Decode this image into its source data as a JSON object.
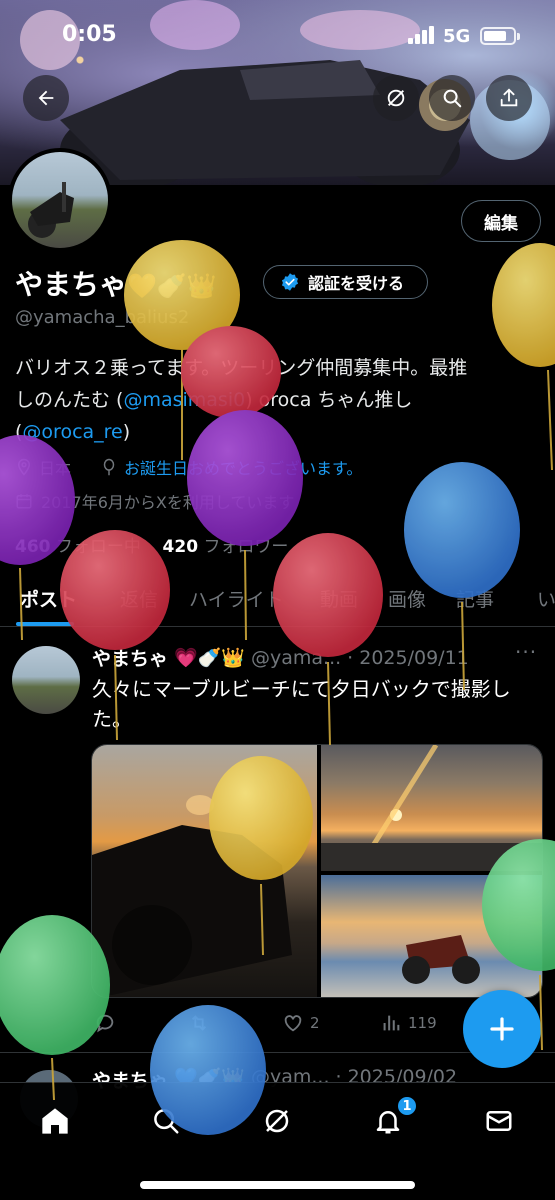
{
  "status_bar": {
    "time": "0:05",
    "network": "5G"
  },
  "header": {
    "back_icon": "arrow-left-icon",
    "grok_icon": "grok-icon",
    "search_icon": "search-icon",
    "share_icon": "share-icon"
  },
  "profile": {
    "edit_label": "編集",
    "name": "やまちゃ",
    "name_emojis": "🧡🍼👑",
    "verify_label": "認証を受ける",
    "handle": "@yamacha_balius2",
    "bio_line1": "バリオス２乗ってます。ツーリング仲間募集中。最推",
    "bio_line2_pre": "しのんたむ (",
    "bio_mention1": "@masimasi0",
    "bio_line2_post": ") oroca ちゃん推し",
    "bio_line3_pre": "(",
    "bio_mention2": "@oroca_re",
    "bio_line3_post": ")",
    "location": "日本",
    "birthday": "お誕生日おめでとうございます。",
    "joined": "2017年6月からXを利用しています",
    "following_count": "460",
    "following_label": "フォロー中",
    "followers_count": "420",
    "followers_label": "フォロワー"
  },
  "tabs": [
    {
      "label": "ポスト"
    },
    {
      "label": "返信"
    },
    {
      "label": "ハイライト"
    },
    {
      "label": "動画"
    },
    {
      "label": "画像"
    },
    {
      "label": "記事"
    },
    {
      "label": "い"
    }
  ],
  "tweet": {
    "name": "やまちゃ",
    "emojis": "💗🍼👑",
    "handle": "@yama...",
    "date": "· 2025/09/11",
    "more": "···",
    "text": "久々にマーブルビーチにて夕日バックで撮影した。",
    "likes": "2",
    "views": "119"
  },
  "tweet2": {
    "name": "やまちゃ",
    "emojis": "💙🍼👑",
    "handle": "@yam...",
    "date": "· 2025/09/02"
  },
  "nav": {
    "notification_badge": "1"
  },
  "colors": {
    "accent": "#1d9bf0",
    "background": "#000000",
    "muted": "#71767b"
  }
}
